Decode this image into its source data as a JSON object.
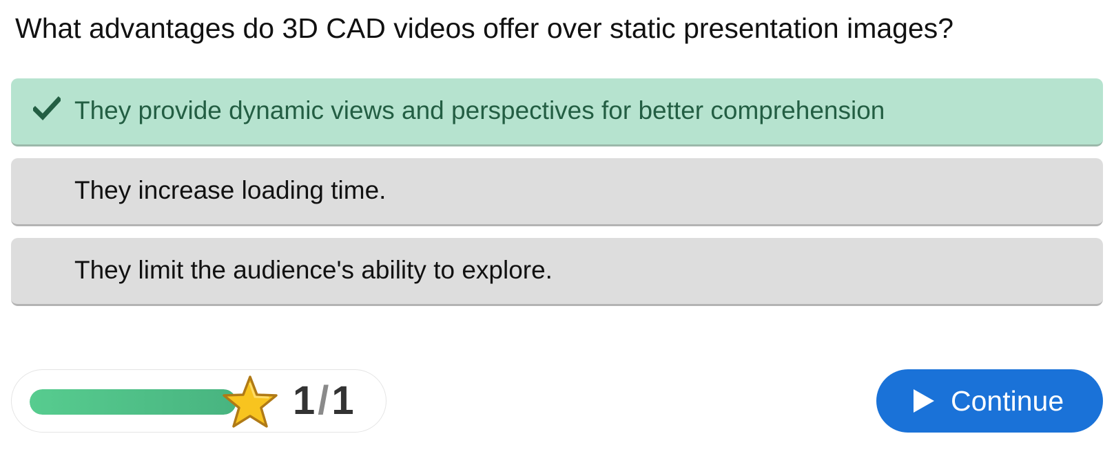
{
  "question": "What advantages do 3D CAD videos offer over static presentation images?",
  "options": [
    {
      "text": "They provide dynamic views and perspectives for better comprehension",
      "state": "correct",
      "icon": "check-icon"
    },
    {
      "text": "They increase loading time.",
      "state": "neutral"
    },
    {
      "text": "They limit the audience's ability to explore.",
      "state": "neutral"
    }
  ],
  "progress": {
    "fraction_filled": 1.0,
    "score": "1",
    "separator": "/",
    "total": "1",
    "icon": "star-icon"
  },
  "continue_button": {
    "label": "Continue",
    "icon": "play-icon"
  },
  "colors": {
    "correct_bg": "#b6e3cf",
    "correct_text": "#235e43",
    "neutral_bg": "#dddddd",
    "progress_fill": "#52c287",
    "star": "#f8c41f",
    "button_bg": "#1a72d8"
  }
}
